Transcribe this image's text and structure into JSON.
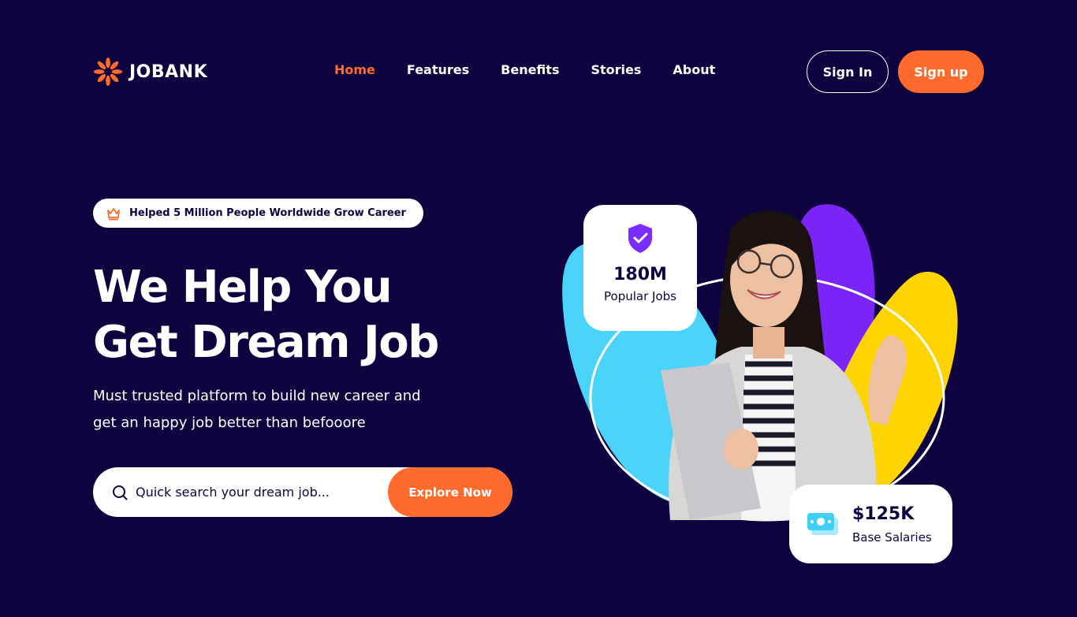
{
  "brand": {
    "name": "JOBANK",
    "icon": "sunburst-logo-icon",
    "accent": "#ff6b2c",
    "background": "#0e023f"
  },
  "nav": {
    "items": [
      {
        "label": "Home",
        "active": true
      },
      {
        "label": "Features",
        "active": false
      },
      {
        "label": "Benefits",
        "active": false
      },
      {
        "label": "Stories",
        "active": false
      },
      {
        "label": "About",
        "active": false
      }
    ],
    "signin_label": "Sign In",
    "signup_label": "Sign up"
  },
  "hero": {
    "badge": {
      "icon": "crown-icon",
      "text": "Helped 5 Million People Worldwide Grow Career"
    },
    "headline_line1": "We Help You",
    "headline_line2": "Get Dream Job",
    "subtitle_line1": "Must trusted platform to build new career and",
    "subtitle_line2": "get an happy job better than befooore",
    "search": {
      "placeholder": "Quick search your dream job...",
      "icon": "search-icon",
      "button_label": "Explore Now"
    }
  },
  "stats": {
    "jobs": {
      "icon": "shield-check-icon",
      "value": "180M",
      "label": "Popular Jobs",
      "icon_color": "#7b2cff"
    },
    "salary": {
      "icon": "money-icon",
      "value": "$125K",
      "label": "Base Salaries",
      "icon_color": "#3fd0f5"
    }
  },
  "art_colors": {
    "cyan": "#4ad3fb",
    "purple": "#7a24f8",
    "yellow": "#ffd400"
  }
}
